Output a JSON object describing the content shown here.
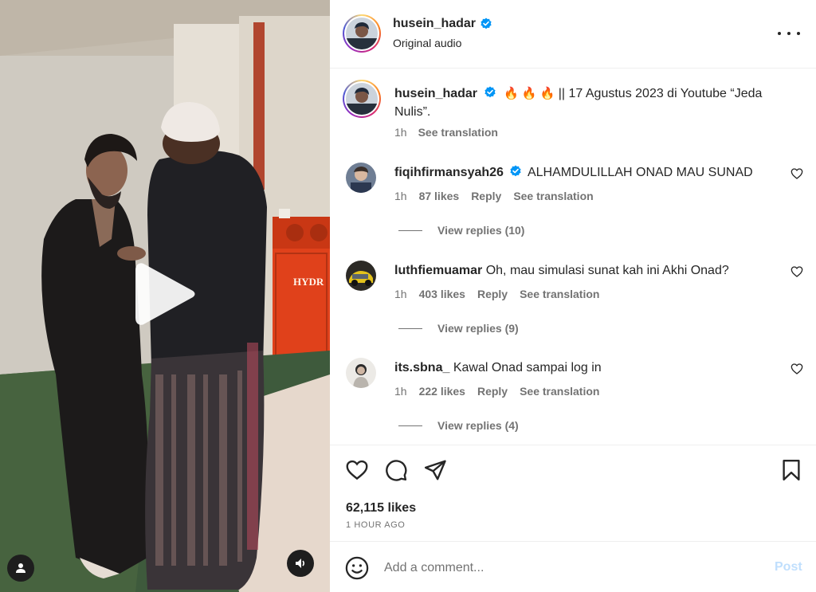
{
  "post": {
    "author": "husein_hadar",
    "audio": "Original audio",
    "caption": {
      "username": "husein_hadar",
      "emojis": "🔥 🔥 🔥",
      "text": "|| 17 Agustus 2023 di Youtube “Jeda Nulis”.",
      "time": "1h",
      "translate": "See translation"
    },
    "likes": "62,115 likes",
    "time_ago": "1 HOUR AGO"
  },
  "comments": [
    {
      "username": "fiqihfirmansyah26",
      "verified": true,
      "text": "ALHAMDULILLAH ONAD MAU SUNAD",
      "time": "1h",
      "likes": "87 likes",
      "reply": "Reply",
      "translate": "See translation",
      "view_replies": "View replies (10)"
    },
    {
      "username": "luthfiemuamar",
      "verified": false,
      "text": "Oh, mau simulasi sunat kah ini Akhi Onad?",
      "time": "1h",
      "likes": "403 likes",
      "reply": "Reply",
      "translate": "See translation",
      "view_replies": "View replies (9)"
    },
    {
      "username": "its.sbna_",
      "verified": false,
      "text": "Kawal Onad sampai log in",
      "time": "1h",
      "likes": "222 likes",
      "reply": "Reply",
      "translate": "See translation",
      "view_replies": "View replies (4)"
    }
  ],
  "composer": {
    "placeholder": "Add a comment...",
    "post_label": "Post"
  },
  "media": {
    "sign_text": "HYDR"
  },
  "colors": {
    "verified": "#0095f6",
    "post_disabled": "#c0dffd",
    "muted_text": "#737373"
  },
  "icons": [
    "verified-badge-icon",
    "more-options-icon",
    "heart-icon",
    "comment-icon",
    "share-icon",
    "bookmark-icon",
    "emoji-icon",
    "play-icon",
    "user-tag-icon",
    "speaker-icon"
  ]
}
